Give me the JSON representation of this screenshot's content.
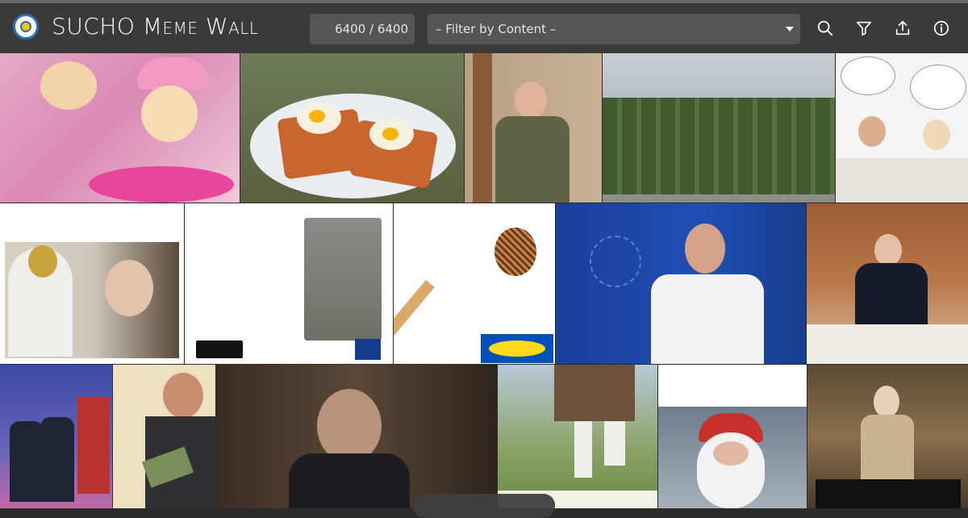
{
  "header": {
    "title_prefix": "SUCHO ",
    "title_sc": "Meme Wall",
    "counter": "6400 / 6400",
    "filter_placeholder": "– Filter by Content –",
    "icons": [
      "search-icon",
      "filter-icon",
      "upload-icon",
      "info-icon"
    ]
  },
  "colors": {
    "topbar": "#3a3a3a",
    "field": "#555555",
    "logo_blue": "#2f6fb0",
    "logo_yellow": "#f2c300"
  }
}
